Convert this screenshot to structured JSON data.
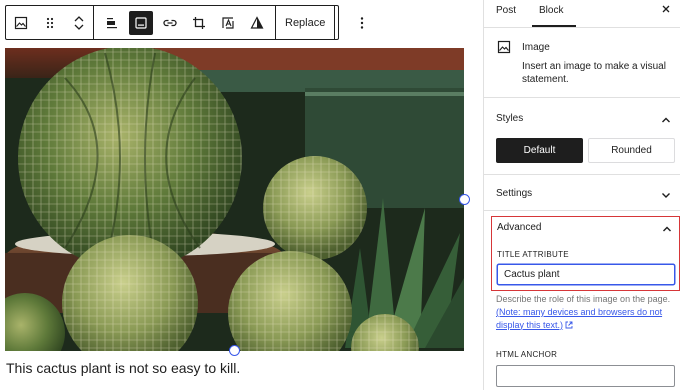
{
  "toolbar": {
    "replace_label": "Replace",
    "icons": [
      "image-icon",
      "drag-icon",
      "move-up-icon",
      "move-down-icon",
      "align-icon",
      "caption-icon",
      "link-icon",
      "crop-icon",
      "text-over-image-icon",
      "duotone-icon",
      "more-options-icon"
    ]
  },
  "canvas": {
    "image_alt": "Cactus plant photo",
    "caption": "This cactus plant is not so easy to kill."
  },
  "sidebar": {
    "tabs": [
      {
        "label": "Post",
        "active": false
      },
      {
        "label": "Block",
        "active": true
      }
    ],
    "close_icon": "close-icon",
    "block_card": {
      "title": "Image",
      "description": "Insert an image to make a visual statement."
    },
    "styles": {
      "title": "Styles",
      "options": [
        "Default",
        "Rounded"
      ],
      "selected": "Default"
    },
    "settings": {
      "title": "Settings"
    },
    "advanced": {
      "title": "Advanced",
      "title_attribute_label": "TITLE ATTRIBUTE",
      "title_attribute_value": "Cactus plant",
      "help_text": "Describe the role of this image on the page.",
      "help_link": "(Note: many devices and browsers do not display this text.)",
      "html_anchor_label": "HTML ANCHOR",
      "html_anchor_value": ""
    }
  },
  "colors": {
    "accent": "#3858e9",
    "highlight_border": "#d63638",
    "dark": "#1e1e1e"
  }
}
